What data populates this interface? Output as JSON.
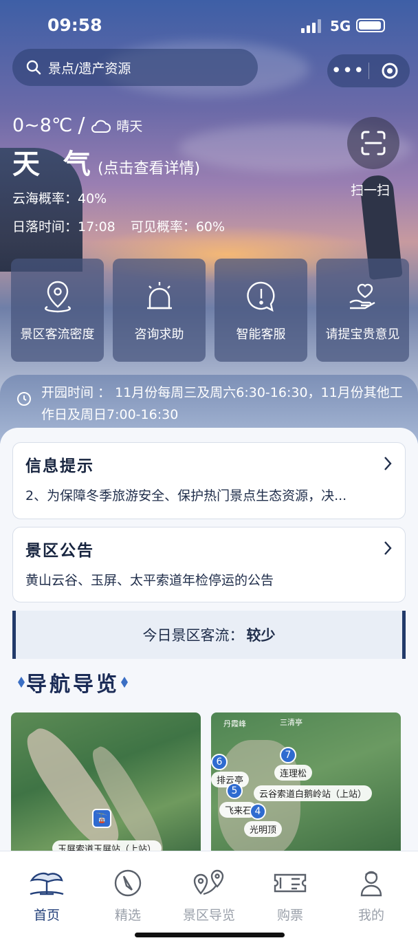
{
  "status_bar": {
    "time": "09:58",
    "network": "5G"
  },
  "search": {
    "placeholder": "景点/遗产资源",
    "icon": "search-icon"
  },
  "weather": {
    "temperature": "0~8℃",
    "separator": "/",
    "condition": "晴天",
    "title": "天 气",
    "detail_hint": "(点击查看详情)",
    "sea_of_clouds": "云海概率：40%",
    "sunset": "日落时间：17:08",
    "visibility": "可见概率：60%"
  },
  "scan": {
    "label": "扫一扫",
    "icon": "scan-icon"
  },
  "quick_actions": [
    {
      "label": "景区客流密度",
      "icon": "location-pin-icon"
    },
    {
      "label": "咨询求助",
      "icon": "alarm-bell-icon"
    },
    {
      "label": "智能客服",
      "icon": "exclamation-chat-icon"
    },
    {
      "label": "请提宝贵意见",
      "icon": "hand-heart-icon"
    }
  ],
  "opening_hours": "开园时间 ： 11月份每周三及周六6:30-16:30，11月份其他工作日及周日7:00-16:30",
  "info_card": {
    "title": "信息提示",
    "body": "2、为保障冬季旅游安全、保护热门景点生态资源，决..."
  },
  "notice_card": {
    "title": "景区公告",
    "body": "黄山云谷、玉屏、太平索道年检停运的公告"
  },
  "visitor_flow": {
    "label": "今日景区客流：",
    "value": "较少"
  },
  "navigation": {
    "title": "导航导览",
    "map1": {
      "station": "玉屏索道玉屏站（上站）"
    },
    "map2": {
      "places": [
        "排云亭",
        "连理松",
        "云谷索道白鹅岭站（上站）",
        "飞来石",
        "光明顶",
        "丹霞峰",
        "三清亭"
      ],
      "pins": [
        "6",
        "7",
        "5",
        "4"
      ]
    }
  },
  "tabbar": [
    {
      "label": "首页",
      "icon": "home-pine-icon",
      "active": true
    },
    {
      "label": "精选",
      "icon": "compass-icon",
      "active": false
    },
    {
      "label": "景区导览",
      "icon": "map-pins-icon",
      "active": false
    },
    {
      "label": "购票",
      "icon": "ticket-icon",
      "active": false
    },
    {
      "label": "我的",
      "icon": "user-icon",
      "active": false
    }
  ],
  "colors": {
    "accent": "#23407a",
    "pin": "#2f6bd0",
    "inactive_tab": "#9aa0aa"
  }
}
